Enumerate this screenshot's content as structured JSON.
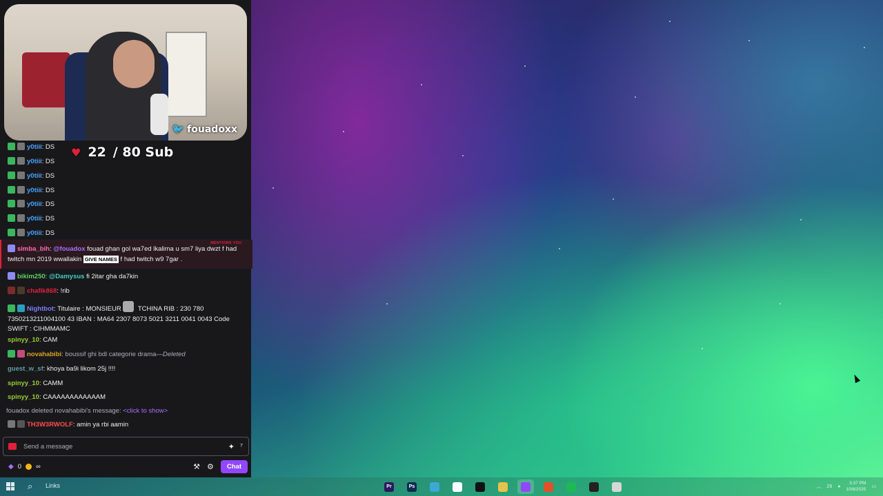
{
  "overlay": {
    "handle": "fouadoxx",
    "goal_count": "22",
    "goal_total": "/ 80 Sub"
  },
  "chat": {
    "ds_messages": [
      {
        "user": "y0tiii",
        "text": ": DS"
      },
      {
        "user": "y0tiii",
        "text": ": DS"
      },
      {
        "user": "y0tiii",
        "text": ": DS"
      },
      {
        "user": "y0tiii",
        "text": ": DS"
      },
      {
        "user": "y0tiii",
        "text": ": DS"
      },
      {
        "user": "y0tiii",
        "text": ": DS"
      },
      {
        "user": "y0tiii",
        "text": ": DS"
      }
    ],
    "mention": {
      "tag": "MENTIONS YOU",
      "user": "simba_bih",
      "at": "@fouadox",
      "text1": " fouad ghan gol wa7ed lkalima u sm7 liya dwzt f had twitch mn 2019 wwallakin ",
      "emote": "GIVE NAMES",
      "text2": " f had twitch w9 7gar ."
    },
    "bikim": {
      "user": "bikim250",
      "at": "@Damysus",
      "text": " fi 2itar gha da7kin"
    },
    "chafik": {
      "user": "chafik868",
      "text": ": !rib"
    },
    "nightbot": {
      "user": "Nightbot",
      "text1": ": Titulaire : MONSIEUR ",
      "text2": " TCHINA RIB : 230 780 7350213211004100 43 IBAN : MA64 2307 8073 5021 3211 0041 0043 Code SWIFT : CIHMMAMC"
    },
    "spinyy1": {
      "user": "spinyy_10",
      "text": ": CAM"
    },
    "nova": {
      "user": "novahabibi",
      "text": ": boussif ghi bdl categorie drama",
      "deleted": "—Deleted"
    },
    "guest": {
      "user": "guest_w_sf",
      "text": ": khoya ba9i likom 25j !!!!"
    },
    "spinyy2": {
      "user": "spinyy_10",
      "text": ": CAMM"
    },
    "spinyy3": {
      "user": "spinyy_10",
      "text": ": CAAAAAAAAAAAAM"
    },
    "system": {
      "text": "fouadox deleted novahabibi's message: ",
      "link": "<click to show>"
    },
    "wolf": {
      "user": "TH3W3RWOLF",
      "text": ": amin ya rbi aamin"
    },
    "input_placeholder": "Send a message",
    "points": "0",
    "infinity": "∞",
    "chat_button": "Chat"
  },
  "taskbar": {
    "links_label": "Links",
    "apps": [
      {
        "icon": "premiere-icon",
        "label": "Pr",
        "color": "#2a1b5e"
      },
      {
        "icon": "photoshop-icon",
        "label": "Ps",
        "color": "#0f2a52"
      },
      {
        "icon": "capcut-icon",
        "label": "",
        "color": "#3da7d8"
      },
      {
        "icon": "discord-icon",
        "label": "",
        "color": "#ffffff"
      },
      {
        "icon": "valorant-icon",
        "label": "",
        "color": "#111111"
      },
      {
        "icon": "file-explorer-icon",
        "label": "",
        "color": "#e8c24a"
      },
      {
        "icon": "twitch-icon",
        "label": "",
        "color": "#9147ff"
      },
      {
        "icon": "brave-icon",
        "label": "",
        "color": "#e0502a"
      },
      {
        "icon": "spotify-icon",
        "label": "",
        "color": "#1db954"
      },
      {
        "icon": "app-icon",
        "label": "",
        "color": "#222222"
      },
      {
        "icon": "chrome-icon",
        "label": "",
        "color": "#d7d7d7"
      }
    ],
    "tray_text": "28",
    "time": "3:37 PM",
    "date": "10/6/2025"
  }
}
